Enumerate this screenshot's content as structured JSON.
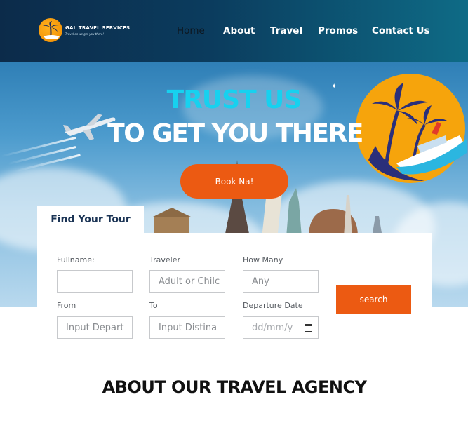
{
  "brand": {
    "name": "GAL TRAVEL SERVICES",
    "tagline": "Travel as we get you there!"
  },
  "nav": {
    "items": [
      {
        "label": "Home",
        "active": true
      },
      {
        "label": "About"
      },
      {
        "label": "Travel"
      },
      {
        "label": "Promos"
      },
      {
        "label": "Contact Us"
      }
    ]
  },
  "hero": {
    "title_line1": "TRUST US",
    "title_line2": "TO GET YOU THERE",
    "cta_label": "Book Na!"
  },
  "search": {
    "tab_label": "Find Your Tour",
    "fields": {
      "fullname": {
        "label": "Fullname:",
        "placeholder": ""
      },
      "traveler": {
        "label": "Traveler",
        "placeholder": "Adult or Chilc"
      },
      "how_many": {
        "label": "How Many",
        "placeholder": "Any"
      },
      "from": {
        "label": "From",
        "placeholder": "Input Depart"
      },
      "to": {
        "label": "To",
        "placeholder": "Input Distina"
      },
      "departure_date": {
        "label": "Departure Date",
        "placeholder": "dd/mm/y"
      }
    },
    "button_label": "search"
  },
  "about": {
    "heading": "ABOUT OUR TRAVEL AGENCY"
  },
  "colors": {
    "accent": "#ec5a12",
    "title_cyan": "#17d1ef",
    "header_dark": "#0c2b4a",
    "heading_line": "#5fb3c0"
  }
}
